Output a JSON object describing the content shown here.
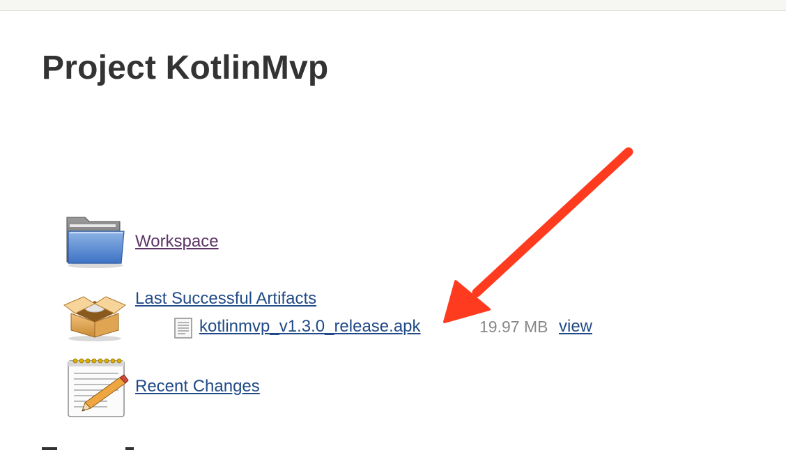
{
  "page": {
    "title": "Project KotlinMvp"
  },
  "tasks": {
    "workspace": {
      "label": "Workspace",
      "icon": "folder-icon"
    },
    "artifacts": {
      "label": "Last Successful Artifacts",
      "icon": "package-box-icon",
      "files": [
        {
          "name": "kotlinmvp_v1.3.0_release.apk",
          "size": "19.97 MB",
          "view_label": "view",
          "icon": "file-icon"
        }
      ]
    },
    "recent_changes": {
      "label": "Recent Changes",
      "icon": "notepad-icon"
    }
  },
  "annotation": {
    "arrow_color": "#ff3b1f"
  },
  "colors": {
    "link": "#204a87",
    "visited_link": "#5c3566",
    "muted_text": "#888888",
    "title": "#333333"
  }
}
